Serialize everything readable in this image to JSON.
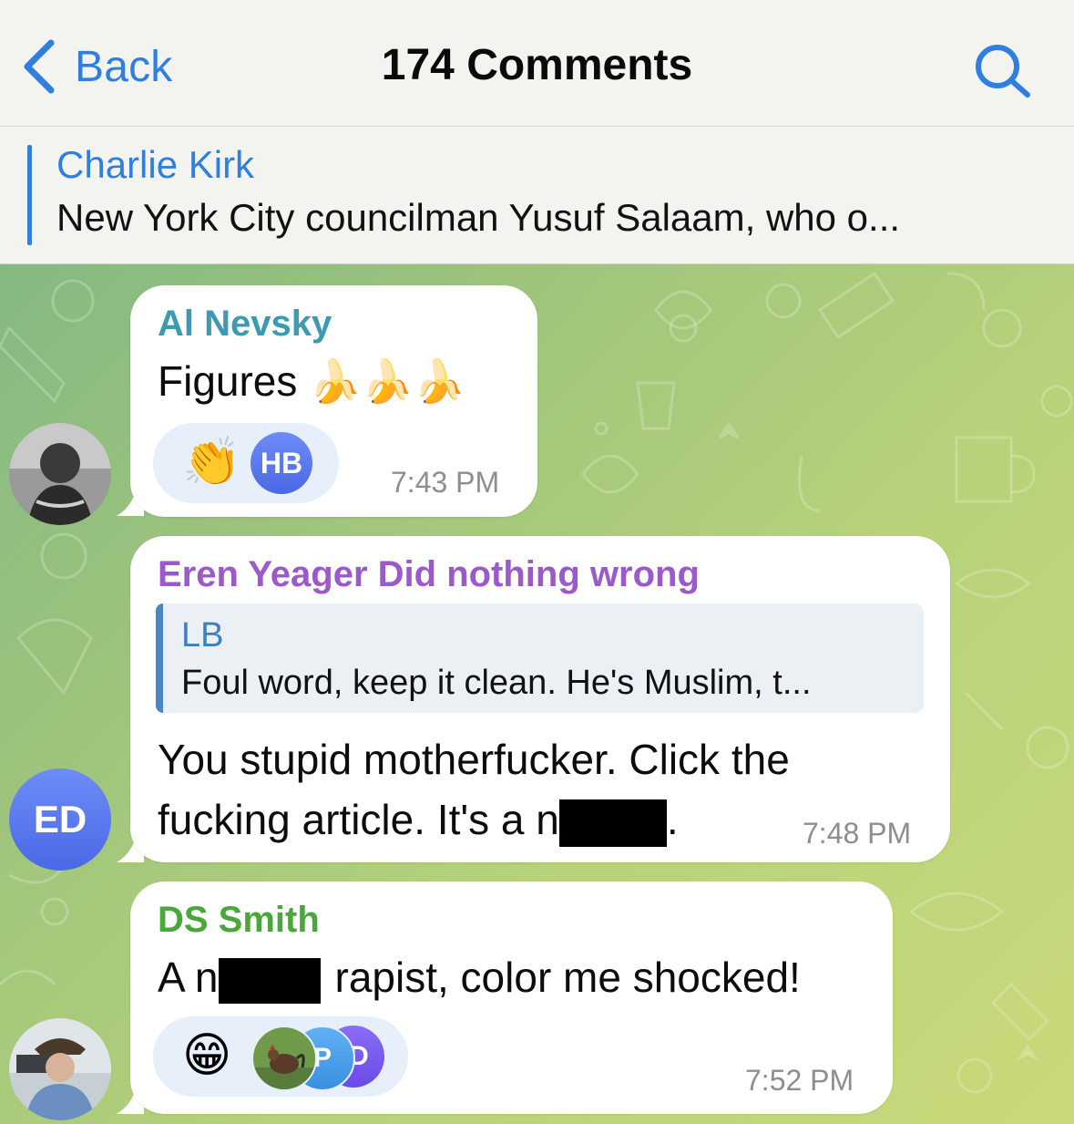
{
  "header": {
    "back_label": "Back",
    "title": "174 Comments",
    "back_icon": "chevron-left-icon",
    "search_icon": "search-icon",
    "accent_color": "#2f7fe0"
  },
  "pinned": {
    "author": "Charlie Kirk",
    "text": "New York City councilman Yusuf Salaam, who o..."
  },
  "messages": [
    {
      "sender": "Al Nevsky",
      "sender_color": "#3a9bb3",
      "text": "Figures 🍌🍌🍌",
      "time": "7:43 PM",
      "reactions": {
        "emoji": "👏",
        "reactor_initials": "HB"
      }
    },
    {
      "sender": "Eren Yeager Did nothing wrong",
      "sender_color": "#9b59c9",
      "avatar_initials": "ED",
      "reply": {
        "author": "LB",
        "text": "Foul word, keep it clean. He's Muslim, t..."
      },
      "line1": "You stupid motherfucker. Click the",
      "line2_pre": "fucking article. It's a n",
      "line2_post": ".",
      "time": "7:48 PM"
    },
    {
      "sender": "DS Smith",
      "sender_color": "#4aa83a",
      "text_pre": "A n",
      "text_post": "rapist, color me shocked!",
      "time": "7:52 PM",
      "reactions": {
        "emoji": "😁",
        "reactor_initials_1": "P",
        "reactor_initials_2": "D"
      }
    }
  ]
}
